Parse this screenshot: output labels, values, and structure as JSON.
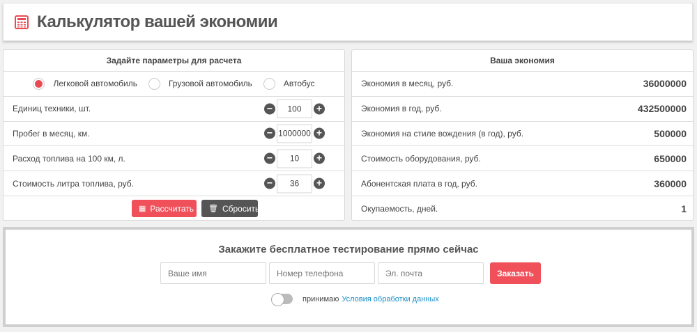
{
  "header": {
    "title": "Калькулятор вашей экономии",
    "icon": "calculator-icon",
    "accent": "#e94b55"
  },
  "params": {
    "title": "Задайте параметры для расчета",
    "vehicle_types": [
      {
        "label": "Легковой автомобиль",
        "checked": true
      },
      {
        "label": "Грузовой автомобиль",
        "checked": false
      },
      {
        "label": "Автобус",
        "checked": false
      }
    ],
    "fields": [
      {
        "label": "Единиц техники, шт.",
        "value": "100"
      },
      {
        "label": "Пробег в месяц, км.",
        "value": "1000000"
      },
      {
        "label": "Расход топлива на 100 км, л.",
        "value": "10"
      },
      {
        "label": "Стоимость литра топлива, руб.",
        "value": "36"
      }
    ],
    "calculate_label": "Рассчитать",
    "reset_label": "Сбросить"
  },
  "savings": {
    "title": "Ваша экономия",
    "rows": [
      {
        "label": "Экономия в месяц, руб.",
        "value": "36000000"
      },
      {
        "label": "Экономия в год, руб.",
        "value": "432500000"
      },
      {
        "label": "Экономия на стиле вождения (в год), руб.",
        "value": "500000"
      },
      {
        "label": "Стоимость оборудования, руб.",
        "value": "650000"
      },
      {
        "label": "Абонентская плата в год, руб.",
        "value": "360000"
      },
      {
        "label": "Окупаемость, дней.",
        "value": "1"
      }
    ]
  },
  "order": {
    "title": "Закажите бесплатное тестирование прямо сейчас",
    "name_placeholder": "Ваше имя",
    "phone_placeholder": "Номер телефона",
    "email_placeholder": "Эл. почта",
    "submit_label": "Заказать",
    "consent_text": "принимаю",
    "consent_link": "Условия обработки данных"
  }
}
